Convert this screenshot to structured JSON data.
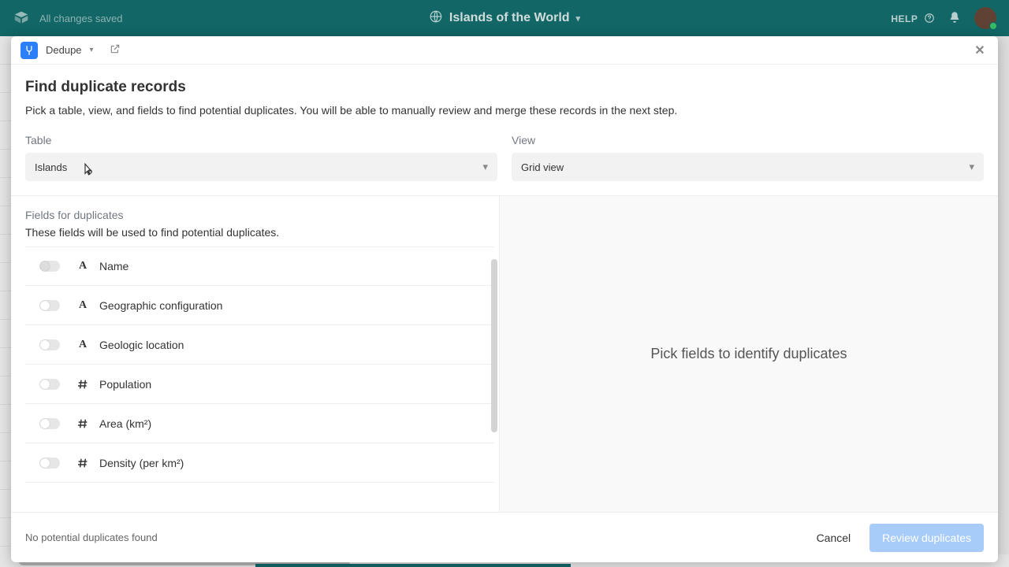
{
  "topbar": {
    "save_status": "All changes saved",
    "base_name": "Islands of the World",
    "help": "HELP"
  },
  "modal": {
    "block_name": "Dedupe",
    "title": "Find duplicate records",
    "subtitle": "Pick a table, view, and fields to find potential duplicates. You will be able to manually review and merge these records in the next step.",
    "table_label": "Table",
    "table_value": "Islands",
    "view_label": "View",
    "view_value": "Grid view",
    "fields_label": "Fields for duplicates",
    "fields_desc": "These fields will be used to find potential duplicates.",
    "fields": [
      {
        "name": "Name",
        "type": "text"
      },
      {
        "name": "Geographic configuration",
        "type": "text"
      },
      {
        "name": "Geologic location",
        "type": "text"
      },
      {
        "name": "Population",
        "type": "num"
      },
      {
        "name": "Area (km²)",
        "type": "num"
      },
      {
        "name": "Density (per km²)",
        "type": "num"
      }
    ],
    "right_message": "Pick fields to identify duplicates",
    "footer_status": "No potential duplicates found",
    "cancel": "Cancel",
    "review": "Review duplicates"
  },
  "icons": {
    "globe": "globe",
    "bell": "bell",
    "help_circle": "help-circle",
    "caret_down": "▾",
    "close": "✕"
  }
}
